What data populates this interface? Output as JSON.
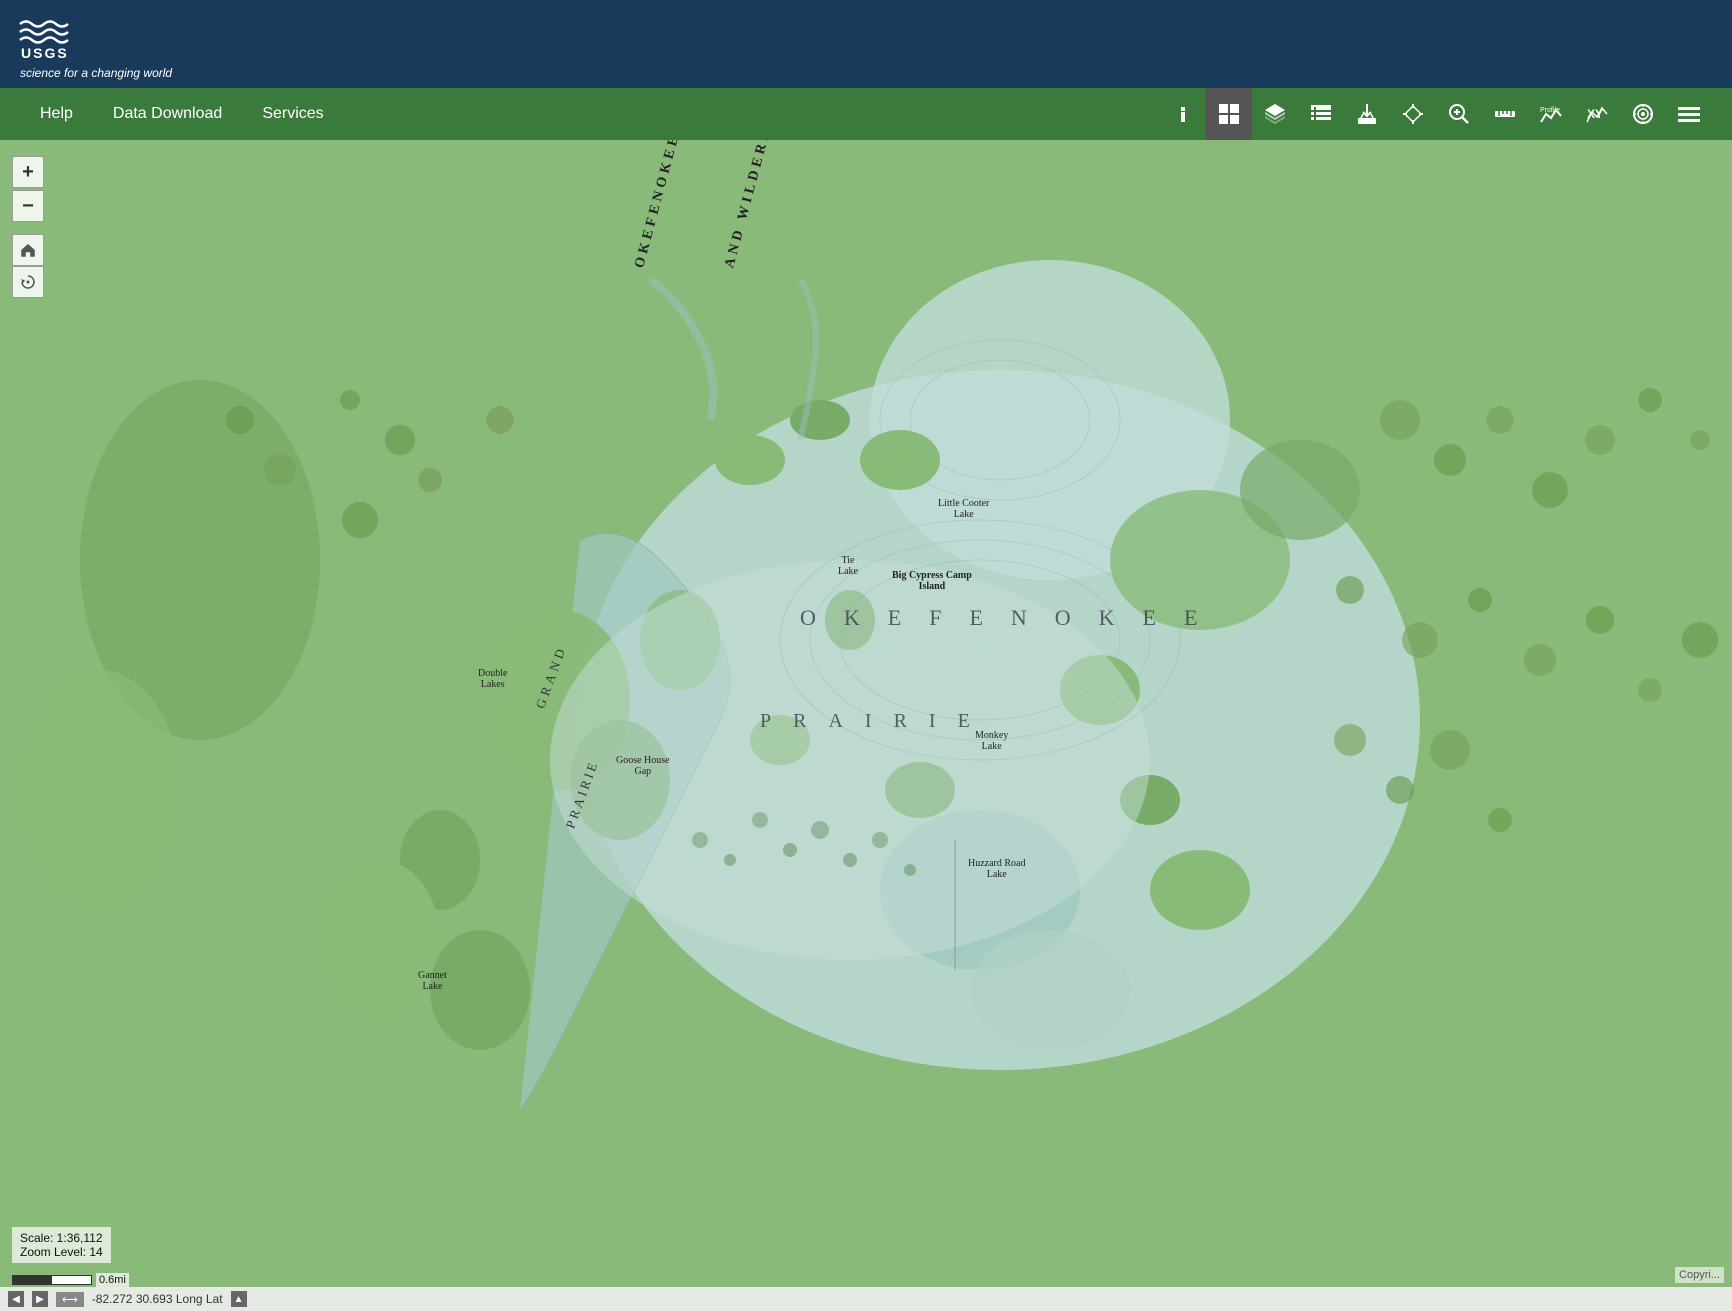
{
  "header": {
    "logo_text": "USGS",
    "logo_tagline": "science for a changing world"
  },
  "navbar": {
    "links": [
      {
        "label": "Help",
        "id": "help"
      },
      {
        "label": "Data Download",
        "id": "data-download"
      },
      {
        "label": "Services",
        "id": "services"
      }
    ]
  },
  "toolbar": {
    "buttons": [
      {
        "id": "info",
        "label": "Info",
        "icon": "info",
        "active": false
      },
      {
        "id": "grid",
        "label": "Grid",
        "icon": "grid",
        "active": true
      },
      {
        "id": "layers",
        "label": "Layers",
        "icon": "layers",
        "active": false
      },
      {
        "id": "list",
        "label": "List",
        "icon": "list",
        "active": false
      },
      {
        "id": "download",
        "label": "Download",
        "icon": "download",
        "active": false
      },
      {
        "id": "crosshair",
        "label": "Crosshair",
        "icon": "crosshair",
        "active": false
      },
      {
        "id": "search",
        "label": "Search",
        "icon": "search",
        "active": false
      },
      {
        "id": "measure",
        "label": "Measure",
        "icon": "measure",
        "active": false
      },
      {
        "id": "profile",
        "label": "Profile",
        "icon": "profile",
        "active": false
      },
      {
        "id": "xy",
        "label": "XY",
        "icon": "xy",
        "active": false
      },
      {
        "id": "target",
        "label": "Target",
        "icon": "target",
        "active": false
      },
      {
        "id": "more",
        "label": "More",
        "icon": "more",
        "active": false
      }
    ]
  },
  "map": {
    "scale": "Scale: 1:36,112",
    "zoom_level": "Zoom Level: 14",
    "scale_bar_label": "0.6mi",
    "coordinates": "-82.272 30.693 Long Lat",
    "place_labels": [
      {
        "text": "Little Cooter Lake",
        "top": "355",
        "left": "940"
      },
      {
        "text": "Tie Lake",
        "top": "415",
        "left": "840"
      },
      {
        "text": "Big Cypress Camp Island",
        "top": "430",
        "left": "895"
      },
      {
        "text": "Double Lakes",
        "top": "528",
        "left": "485"
      },
      {
        "text": "Goose House Gap",
        "top": "615",
        "left": "625"
      },
      {
        "text": "Monkey Lake",
        "top": "590",
        "left": "980"
      },
      {
        "text": "Huzzard Road Lake",
        "top": "718",
        "left": "970"
      },
      {
        "text": "Gannet Lake",
        "top": "830",
        "left": "420"
      },
      {
        "text": "OKEFENOKEE",
        "top": "480",
        "left": "770",
        "class": "large"
      },
      {
        "text": "PRAIRIE",
        "top": "540",
        "left": "820",
        "class": "large"
      }
    ]
  },
  "status_bar": {
    "coordinates_label": "-82.272 30.693 Long Lat",
    "toggle_label": "⟷",
    "copyright": "Copyri..."
  }
}
